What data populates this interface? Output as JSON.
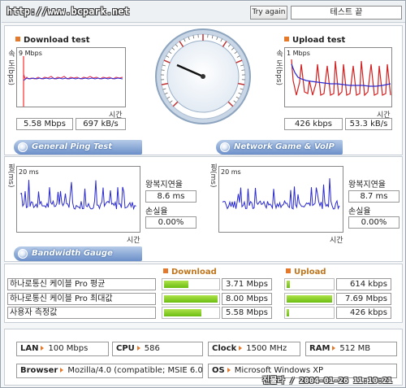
{
  "header": {
    "watermark": "http://www.bcpark.net",
    "try_again": "Try again",
    "status": "테스트 끝"
  },
  "download": {
    "title": "Download test",
    "ylabel": "속 도(bps)",
    "scale": "9 Mbps",
    "xlabel": "시간",
    "speed": "5.58 Mbps",
    "rate": "697 kB/s"
  },
  "upload": {
    "title": "Upload test",
    "ylabel": "속 도(bps)",
    "scale": "1 Mbps",
    "xlabel": "시간",
    "speed": "426 kbps",
    "rate": "53.3 kB/s"
  },
  "buttons": {
    "general_ping": "General Ping Test",
    "network_game": "Network Game & VoIP Test",
    "bandwidth_gauge": "Bandwidth Gauge"
  },
  "ping_left": {
    "ylabel": "핑(ms)",
    "scale": "20 ms",
    "xlabel": "시간",
    "latency_label": "왕복지연율",
    "latency": "8.6 ms",
    "loss_label": "손실율",
    "loss": "0.00%"
  },
  "ping_right": {
    "ylabel": "핑(ms)",
    "scale": "20 ms",
    "xlabel": "시간",
    "latency_label": "왕복지연율",
    "latency": "8.7 ms",
    "loss_label": "손실율",
    "loss": "0.00%"
  },
  "results": {
    "download_head": "Download",
    "upload_head": "Upload",
    "rows": [
      {
        "label": "하나로통신 케이블 Pro 평균",
        "download": "3.71 Mbps",
        "download_fill": 0.46,
        "upload": "614 kbps",
        "upload_fill": 0.08
      },
      {
        "label": "하나로통신 케이블 Pro 최대값",
        "download": "8.00 Mbps",
        "download_fill": 1.0,
        "upload": "7.69 Mbps",
        "upload_fill": 1.0
      },
      {
        "label": "사용자 측정값",
        "download": "5.58 Mbps",
        "download_fill": 0.7,
        "upload": "426 kbps",
        "upload_fill": 0.05
      }
    ]
  },
  "system": {
    "lan_label": "LAN",
    "lan": "100 Mbps",
    "cpu_label": "CPU",
    "cpu": "586",
    "clock_label": "Clock",
    "clock": "1500 MHz",
    "ram_label": "RAM",
    "ram": "512 MB",
    "browser_label": "Browser",
    "browser": "Mozilla/4.0 (compatible; MSIE 6.0",
    "os_label": "OS",
    "os": "Microsoft Windows XP"
  },
  "stamp": "진물라 / 2004-01-26 11:10:21",
  "colors": {
    "accent": "#e4782b",
    "button_blue": "#6b8fc9",
    "bar_green": "#6cbd12",
    "download_line": "#2a2ad0",
    "upload_line": "#d02020"
  }
}
